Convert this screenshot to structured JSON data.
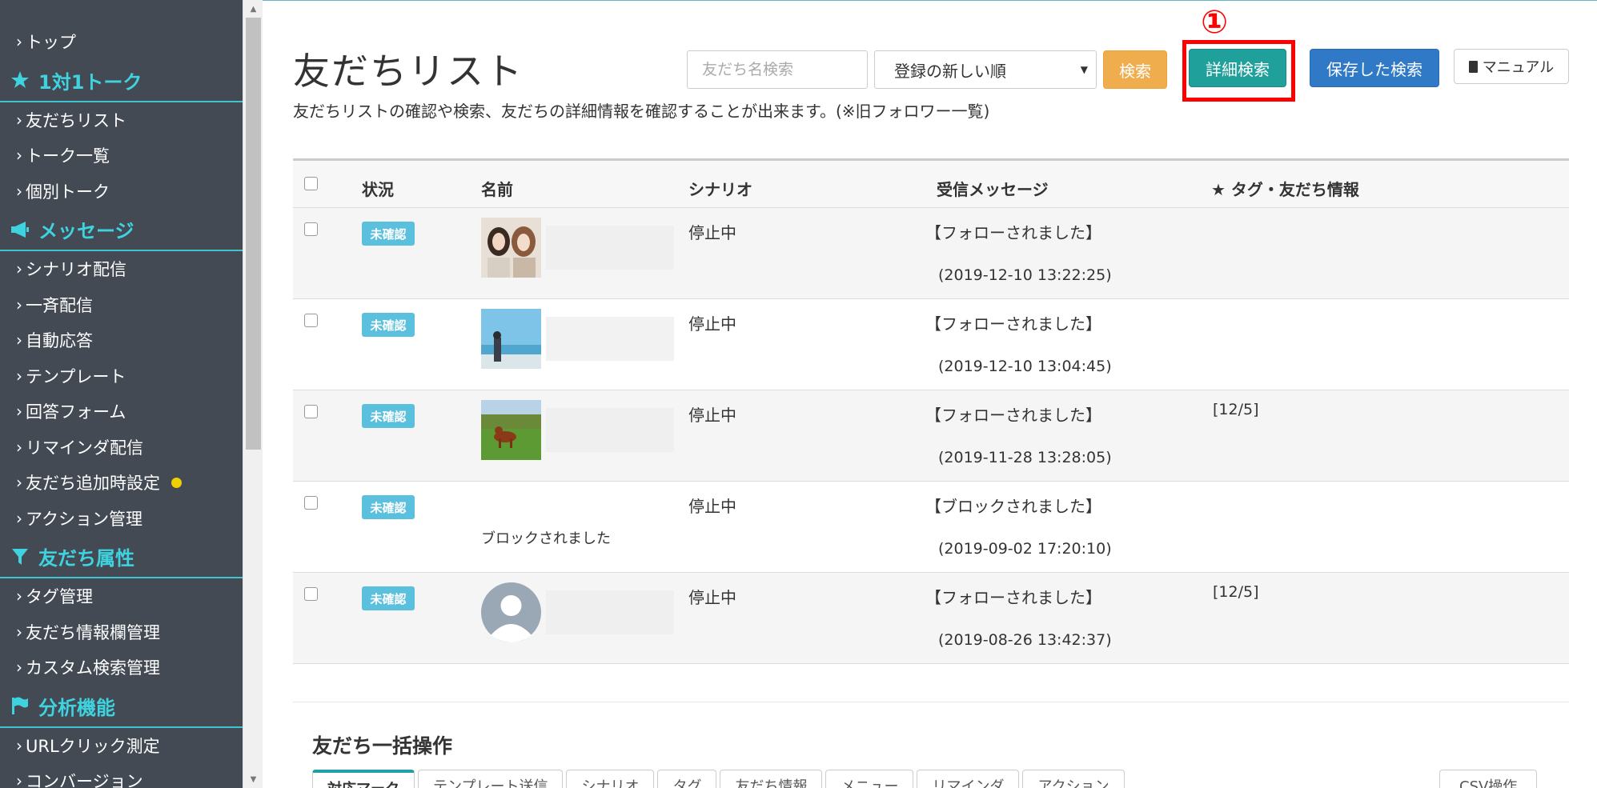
{
  "sidebar": {
    "items": [
      {
        "type": "item",
        "label": "トップ"
      },
      {
        "type": "head",
        "label": "1対1トーク",
        "icon": "star-icon"
      },
      {
        "type": "item",
        "label": "友だちリスト"
      },
      {
        "type": "item",
        "label": "トーク一覧"
      },
      {
        "type": "item",
        "label": "個別トーク"
      },
      {
        "type": "head",
        "label": "メッセージ",
        "icon": "megaphone-icon"
      },
      {
        "type": "item",
        "label": "シナリオ配信"
      },
      {
        "type": "item",
        "label": "一斉配信"
      },
      {
        "type": "item",
        "label": "自動応答"
      },
      {
        "type": "item",
        "label": "テンプレート"
      },
      {
        "type": "item",
        "label": "回答フォーム"
      },
      {
        "type": "item",
        "label": "リマインダ配信"
      },
      {
        "type": "item",
        "label": "友だち追加時設定",
        "dot": true
      },
      {
        "type": "item",
        "label": "アクション管理"
      },
      {
        "type": "head",
        "label": "友だち属性",
        "icon": "filter-icon"
      },
      {
        "type": "item",
        "label": "タグ管理"
      },
      {
        "type": "item",
        "label": "友だち情報欄管理"
      },
      {
        "type": "item",
        "label": "カスタム検索管理"
      },
      {
        "type": "head",
        "label": "分析機能",
        "icon": "flag-icon"
      },
      {
        "type": "item",
        "label": "URLクリック測定"
      },
      {
        "type": "item",
        "label": "コンバージョン"
      }
    ],
    "accent_color": "#3fd3e0",
    "background": "#434a54"
  },
  "page": {
    "title": "友だちリスト",
    "description": "友だちリストの確認や検索、友だちの詳細情報を確認することが出来ます。(※旧フォロワー一覧)"
  },
  "toolbar": {
    "name_search_placeholder": "友だち名検索",
    "sort_value": "登録の新しい順",
    "search_label": "検索",
    "detail_search_label": "詳細検索",
    "saved_search_label": "保存した検索",
    "manual_label": "マニュアル",
    "annotation_number": "①"
  },
  "table": {
    "headers": {
      "status": "状況",
      "name": "名前",
      "scenario": "シナリオ",
      "message": "受信メッセージ",
      "tags": "★ タグ・友だち情報"
    },
    "rows": [
      {
        "status": "未確認",
        "avatar": "photo-two-women",
        "name": "",
        "scenario": "停止中",
        "message": "【フォローされました】",
        "time": "(2019-12-10 13:22:25)",
        "tag": ""
      },
      {
        "status": "未確認",
        "avatar": "photo-beach",
        "name": "",
        "scenario": "停止中",
        "message": "【フォローされました】",
        "time": "(2019-12-10 13:04:45)",
        "tag": ""
      },
      {
        "status": "未確認",
        "avatar": "photo-dog-park",
        "name": "",
        "scenario": "停止中",
        "message": "【フォローされました】",
        "time": "(2019-11-28 13:28:05)",
        "tag": "[12/5]"
      },
      {
        "status": "未確認",
        "avatar": "none",
        "name": "ブロックされました",
        "scenario": "停止中",
        "message": "【ブロックされました】",
        "time": "(2019-09-02 17:20:10)",
        "tag": ""
      },
      {
        "status": "未確認",
        "avatar": "default-user",
        "name": "",
        "scenario": "停止中",
        "message": "【フォローされました】",
        "time": "(2019-08-26 13:42:37)",
        "tag": "[12/5]"
      }
    ]
  },
  "bulk": {
    "title": "友だち一括操作",
    "tabs": [
      "対応マーク",
      "テンプレート送信",
      "シナリオ",
      "タグ",
      "友だち情報",
      "メニュー",
      "リマインダ",
      "アクション"
    ],
    "csv_tab": "CSV操作"
  }
}
